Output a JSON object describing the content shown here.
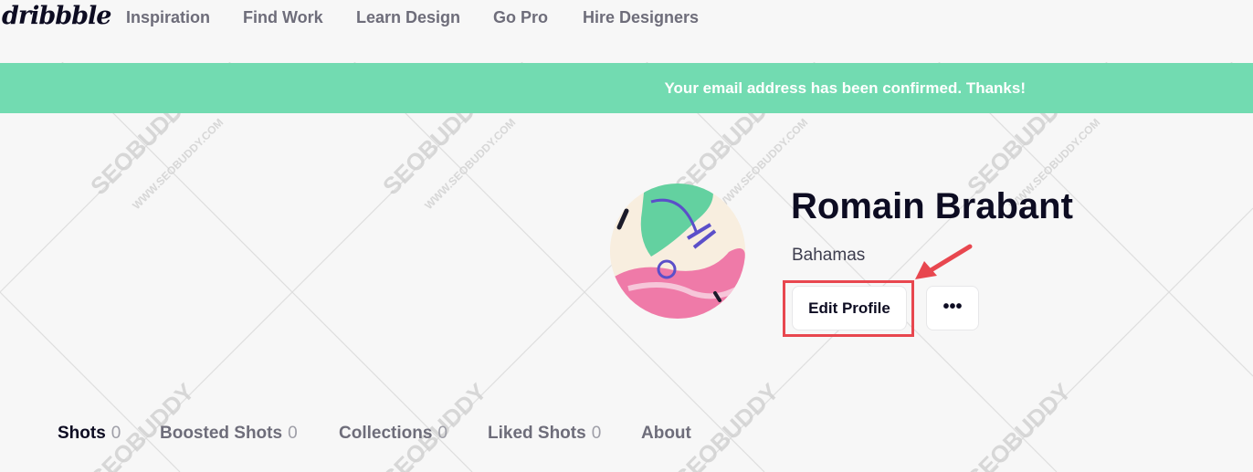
{
  "nav": {
    "logo": "dribbble",
    "items": [
      "Inspiration",
      "Find Work",
      "Learn Design",
      "Go Pro",
      "Hire Designers"
    ]
  },
  "banner": {
    "message": "Your email address has been confirmed. Thanks!"
  },
  "profile": {
    "name": "Romain Brabant",
    "location": "Bahamas",
    "edit_label": "Edit Profile",
    "more_label": "•••"
  },
  "tabs": [
    {
      "label": "Shots",
      "count": "0"
    },
    {
      "label": "Boosted Shots",
      "count": "0"
    },
    {
      "label": "Collections",
      "count": "0"
    },
    {
      "label": "Liked Shots",
      "count": "0"
    },
    {
      "label": "About",
      "count": ""
    }
  ],
  "watermark": {
    "brand": "SEOBUDDY",
    "url": "WWW.SEOBUDDY.COM"
  },
  "colors": {
    "banner": "#72dbb1",
    "highlight": "#e8474f",
    "text": "#0d0c22",
    "muted": "#6e6d7a"
  }
}
